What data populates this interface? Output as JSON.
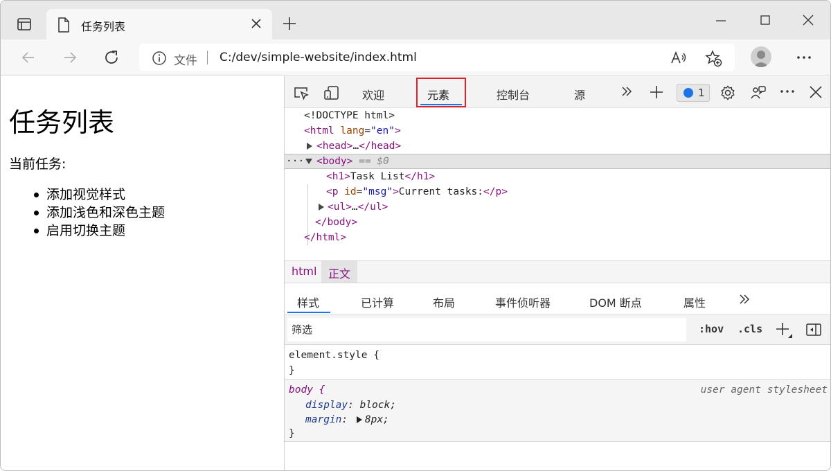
{
  "browser": {
    "tab_title": "任务列表",
    "address": {
      "scheme_label": "文件",
      "url": "C:/dev/simple-website/index.html"
    }
  },
  "page": {
    "heading": "任务列表",
    "msg": "当前任务:",
    "items": [
      "添加视觉样式",
      "添加浅色和深色主题",
      "启用切换主题"
    ]
  },
  "devtools": {
    "tabs": {
      "welcome": "欢迎",
      "elements": "元素",
      "console": "控制台",
      "sources": "源"
    },
    "issues_count": "1",
    "dom": {
      "doctype": "<!DOCTYPE html>",
      "html_open_tag": "<html",
      "html_attr": "lang",
      "html_attr_val": "\"en\"",
      "close_gt": ">",
      "head": "<head>",
      "ellipsis": "…",
      "head_close": "</head>",
      "body_open": "<body>",
      "selected_marker": "== $0",
      "h1_open": "<h1>",
      "h1_text": "Task List",
      "h1_close": "</h1>",
      "p_open": "<p",
      "p_attr": "id",
      "p_attr_val": "\"msg\"",
      "p_text": "Current tasks:",
      "p_close": "</p>",
      "ul_open": "<ul>",
      "ul_close": "</ul>",
      "body_close": "</body>",
      "html_close": "</html>",
      "dots": "···"
    },
    "breadcrumbs": [
      "html",
      "正文"
    ],
    "subtabs": {
      "styles": "样式",
      "computed": "已计算",
      "layout": "布局",
      "listeners": "事件侦听器",
      "dom_breakpoints": "DOM 断点",
      "properties": "属性"
    },
    "filter_placeholder": "筛选",
    "hov": ":hov",
    "cls": ".cls",
    "styles": {
      "element_style_selector": "element.style {",
      "close_brace": "}",
      "body_selector": "body {",
      "ua_label": "user agent stylesheet",
      "display_prop": "display",
      "display_val": "block;",
      "margin_prop": "margin",
      "margin_val": "8px;",
      "colon": ":"
    }
  }
}
